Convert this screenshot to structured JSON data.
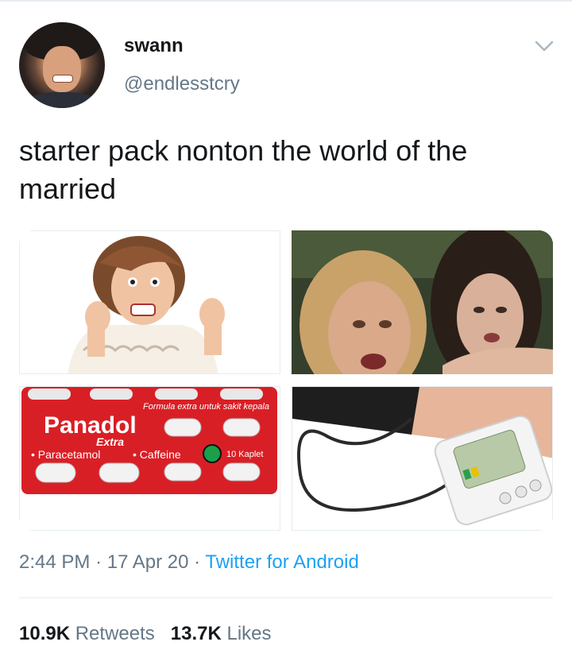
{
  "user": {
    "display_name": "swann",
    "handle": "@endlesstcry"
  },
  "tweet": {
    "text": "starter pack nonton the world of the married",
    "time": "2:44 PM",
    "separator": "·",
    "date": "17 Apr 20",
    "source": "Twitter for Android"
  },
  "media": {
    "images": [
      {
        "alt_icon": "angry-woman-image"
      },
      {
        "alt_icon": "crying-women-image"
      },
      {
        "alt_icon": "panadol-blister-image",
        "brand": "Panadol",
        "variant": "Extra",
        "banner": "Formula extra untuk sakit kepala",
        "ingredient1": "• Paracetamol",
        "ingredient2": "• Caffeine",
        "count": "10 Kaplet"
      },
      {
        "alt_icon": "blood-pressure-monitor-image"
      }
    ]
  },
  "stats": {
    "retweets_count": "10.9K",
    "retweets_label": "Retweets",
    "likes_count": "13.7K",
    "likes_label": "Likes"
  },
  "colors": {
    "link": "#1da1f2",
    "secondary_text": "#657786",
    "panadol_red": "#d91f26"
  }
}
